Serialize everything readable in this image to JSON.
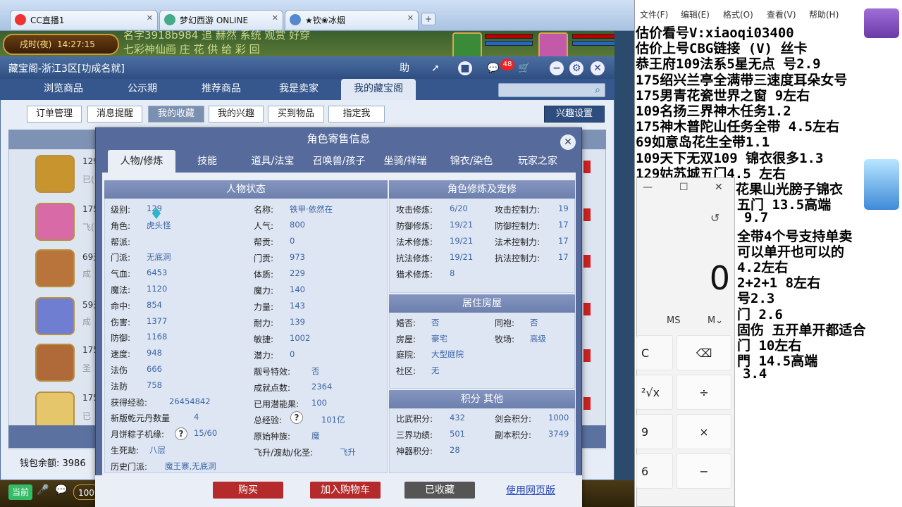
{
  "browser": {
    "tabs": [
      {
        "label": "CC直播1"
      },
      {
        "label": "梦幻西游 ONLINE"
      },
      {
        "label": "★钦❀冰烟"
      }
    ],
    "new_tab": "+"
  },
  "game": {
    "clock": "戌时(夜)  14:27:15",
    "marquee_line1": "名字3918b984 追 赫然 系统 观赏 好穿",
    "marquee_line2": "七彩神仙画             庄 花 供 给 彩 回",
    "bottom": {
      "current": "当前",
      "coin": "100"
    }
  },
  "panel": {
    "title": "藏宝阁-浙江3区[功成名就]",
    "toolbar": {
      "help": "助",
      "badge": "48"
    },
    "nav": [
      "浏览商品",
      "公示期",
      "推荐商品",
      "我是卖家",
      "我的藏宝阁"
    ],
    "subnav": [
      "订单管理",
      "消息提醒",
      "我的收藏",
      "我的兴趣",
      "买到物品",
      "指定我"
    ],
    "interest_btn": "兴趣设置",
    "list_rows": [
      {
        "num": "129",
        "sub": "已("
      },
      {
        "num": "175",
        "sub": "飞("
      },
      {
        "num": "69天",
        "sub": "成"
      },
      {
        "num": "59天",
        "sub": "成"
      },
      {
        "num": "175",
        "sub": "圣"
      },
      {
        "num": "175",
        "sub": "已"
      }
    ],
    "wallet": "钱包余额: 3986"
  },
  "dialog": {
    "title": "角色寄售信息",
    "tabs": [
      "人物/修炼",
      "技能",
      "道具/法宝",
      "召唤兽/孩子",
      "坐骑/祥瑞",
      "锦衣/染色",
      "玩家之家"
    ],
    "status": {
      "heading": "人物状态",
      "left": [
        {
          "k": "级别:",
          "v": "129"
        },
        {
          "k": "角色:",
          "v": "虎头怪"
        },
        {
          "k": "帮派:",
          "v": ""
        },
        {
          "k": "门派:",
          "v": "无底洞"
        },
        {
          "k": "气血:",
          "v": "6453"
        },
        {
          "k": "魔法:",
          "v": "1120"
        },
        {
          "k": "命中:",
          "v": "854"
        },
        {
          "k": "伤害:",
          "v": "1377"
        },
        {
          "k": "防御:",
          "v": "1168"
        },
        {
          "k": "速度:",
          "v": "948"
        },
        {
          "k": "法伤",
          "v": "666"
        },
        {
          "k": "法防",
          "v": "758"
        },
        {
          "k": "获得经验:",
          "v": "26454842"
        },
        {
          "k": "新版乾元丹数量",
          "v": "4"
        },
        {
          "k": "月饼粽子机缘:",
          "v": "15/60"
        },
        {
          "k": "生死劫:",
          "v": "八层"
        },
        {
          "k": "历史门派:",
          "v": "魔王寨,无底洞"
        }
      ],
      "right": [
        {
          "k": "名称:",
          "v": "铁甲·依然在"
        },
        {
          "k": "人气:",
          "v": "800"
        },
        {
          "k": "帮贡:",
          "v": "0"
        },
        {
          "k": "门贡:",
          "v": "973"
        },
        {
          "k": "体质:",
          "v": "229"
        },
        {
          "k": "魔力:",
          "v": "140"
        },
        {
          "k": "力量:",
          "v": "143"
        },
        {
          "k": "耐力:",
          "v": "139"
        },
        {
          "k": "敏捷:",
          "v": "1002"
        },
        {
          "k": "潜力:",
          "v": "0"
        },
        {
          "k": "靓号特效:",
          "v": "否"
        },
        {
          "k": "成就点数:",
          "v": "2364"
        },
        {
          "k": "已用潜能果:",
          "v": "100"
        },
        {
          "k": "总经验:",
          "v": "101亿"
        },
        {
          "k": "原始种族:",
          "v": "魔"
        },
        {
          "k": "飞升/渡劫/化圣:",
          "v": "飞升"
        }
      ]
    },
    "cultivation": {
      "heading": "角色修炼及宠修",
      "left": [
        {
          "k": "攻击修炼:",
          "v": "6/20"
        },
        {
          "k": "防御修炼:",
          "v": "19/21"
        },
        {
          "k": "法术修炼:",
          "v": "19/21"
        },
        {
          "k": "抗法修炼:",
          "v": "19/21"
        },
        {
          "k": "猎术修炼:",
          "v": "8"
        }
      ],
      "right": [
        {
          "k": "攻击控制力:",
          "v": "19"
        },
        {
          "k": "防御控制力:",
          "v": "17"
        },
        {
          "k": "法术控制力:",
          "v": "17"
        },
        {
          "k": "抗法控制力:",
          "v": "17"
        }
      ]
    },
    "house": {
      "heading": "居住房屋",
      "left": [
        {
          "k": "婚否:",
          "v": "否"
        },
        {
          "k": "房屋:",
          "v": "豪宅"
        },
        {
          "k": "庭院:",
          "v": "大型庭院"
        },
        {
          "k": "社区:",
          "v": "无"
        }
      ],
      "right": [
        {
          "k": "同袍:",
          "v": "否"
        },
        {
          "k": "牧场:",
          "v": "高级"
        }
      ]
    },
    "points": {
      "heading": "积分 其他",
      "left": [
        {
          "k": "比武积分:",
          "v": "432"
        },
        {
          "k": "三界功绩:",
          "v": "501"
        },
        {
          "k": "神器积分:",
          "v": "28"
        }
      ],
      "right": [
        {
          "k": "剑会积分:",
          "v": "1000"
        },
        {
          "k": "副本积分:",
          "v": "3749"
        }
      ]
    },
    "qmark": "?",
    "buttons": {
      "buy": "购买",
      "cart": "加入购物车",
      "fav": "已收藏",
      "web": "使用网页版"
    }
  },
  "notepad": {
    "menu": [
      "文件(F)",
      "编辑(E)",
      "格式(O)",
      "查看(V)",
      "帮助(H)"
    ],
    "lines": [
      "估价看号V:xiaoqi03400",
      "估价上号CBG链接 (V) 丝卡",
      "恭王府109法系5星无点 号2.9",
      "175绍兴兰亭全满带三速度耳朵女号",
      "175男青花瓷世界之窗  9左右",
      "109名扬三界神木任务1.2",
      "175神木普陀山任务全带 4.5左右",
      "69如意岛花生全带1.1",
      "109天下无双109  锦衣很多1.3",
      "129姑苏城五门4.5 左右"
    ],
    "lines_partial": [
      "花果山光膀子锦衣",
      "五门  13.5高端",
      "9.7",
      "全带4个号支持单卖",
      "可以单开也可以的",
      "4.2左右",
      "2+2+1 8左右",
      "号2.3",
      "门  2.6",
      "固伤 五开单开都适合",
      "门  10左右",
      "門 14.5高端",
      "3.4"
    ]
  },
  "calculator": {
    "min": "—",
    "max": "☐",
    "close": "✕",
    "history_icon": "history-icon",
    "display": "0",
    "mem": [
      "MS",
      "M⌄"
    ],
    "keys": [
      {
        "l": "C",
        "r": "⌫"
      },
      {
        "l": "²√x",
        "r": "÷"
      },
      {
        "l": "9",
        "r": "×"
      },
      {
        "l": "6",
        "r": "−"
      }
    ]
  }
}
